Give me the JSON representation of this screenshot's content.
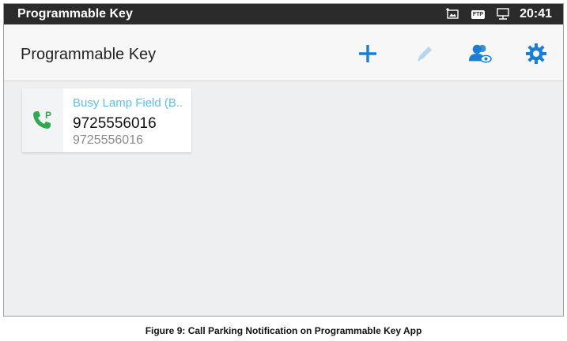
{
  "statusbar": {
    "title": "Programmable Key",
    "ftp_badge": "FTP",
    "time": "20:41"
  },
  "appbar": {
    "title": "Programmable Key",
    "actions": [
      "plus-icon",
      "edit-icon",
      "contacts-view-icon",
      "gear-icon"
    ],
    "accent_color": "#1a7fd4",
    "disabled_color": "#b7d6ee"
  },
  "keys": [
    {
      "label": "Busy Lamp Field (B..",
      "number": "9725556016",
      "sub": "9725556016",
      "icon": "call-park-icon",
      "icon_color": "#2fa84f"
    }
  ],
  "caption": "Figure 9: Call Parking Notification on Programmable Key App"
}
